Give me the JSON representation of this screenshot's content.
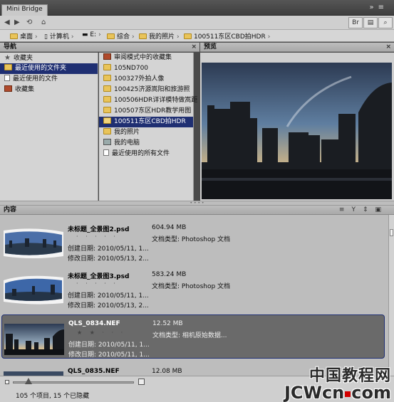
{
  "window": {
    "title": "Mini Bridge"
  },
  "pathbar": {
    "crumbs": [
      "桌面",
      "计算机",
      "E:",
      "综合",
      "我的照片",
      "100511东区CBD拍HDR"
    ]
  },
  "nav_panel": {
    "title": "导航",
    "left_items": [
      {
        "label": "收藏夹",
        "icon": "star-icon"
      },
      {
        "label": "最近使用的文件夹",
        "icon": "recent-folder-icon",
        "selected": true
      },
      {
        "label": "最近使用的文件",
        "icon": "recent-file-icon"
      },
      {
        "label": "收藏集",
        "icon": "collection-icon"
      }
    ],
    "right_items": [
      {
        "label": "审阅模式中的收藏集",
        "icon": "collection-icon"
      },
      {
        "label": "105ND700",
        "icon": "folder-icon"
      },
      {
        "label": "100327外拍人像",
        "icon": "folder-icon"
      },
      {
        "label": "100425济源嵩阳和旅游照",
        "icon": "folder-icon"
      },
      {
        "label": "100506HDR详详模特做嵩距",
        "icon": "folder-icon"
      },
      {
        "label": "100507东区HDR教学用图",
        "icon": "folder-icon"
      },
      {
        "label": "100511东区CBD拍HDR",
        "icon": "folder-icon",
        "selected": true
      },
      {
        "label": "我的照片",
        "icon": "folder-icon"
      },
      {
        "label": "我的电脑",
        "icon": "computer-icon"
      },
      {
        "label": "最近使用的所有文件",
        "icon": "recent-file-icon"
      }
    ]
  },
  "preview_panel": {
    "title": "预览"
  },
  "content_panel": {
    "title": "内容",
    "items": [
      {
        "name": "未标题_全景图2.psd",
        "rating": "· · · · ·",
        "created": "创建日期: 2010/05/11, 1...",
        "modified": "修改日期: 2010/05/13, 2...",
        "size": "604.94 MB",
        "type": "文档类型: Photoshop 文档"
      },
      {
        "name": "未标题_全景图3.psd",
        "rating": "· · · · ·",
        "created": "创建日期: 2010/05/11, 1...",
        "modified": "修改日期: 2010/05/13, 2...",
        "size": "583.24 MB",
        "type": "文档类型: Photoshop 文档"
      },
      {
        "name": "QLS_0834.NEF",
        "rating": "★ ★ · · ·",
        "created": "创建日期: 2010/05/11, 1...",
        "modified": "修改日期: 2010/05/11, 1...",
        "size": "12.52 MB",
        "type": "文档类型: 相机原始数据...",
        "selected": true
      },
      {
        "name": "QLS_0835.NEF",
        "rating": "",
        "created": "",
        "modified": "",
        "size": "12.08 MB",
        "type": ""
      }
    ]
  },
  "status": {
    "text": "105 个项目, 15 个已隐藏"
  },
  "watermark": {
    "line1": "中国教程网",
    "line2_a": "JCWcn",
    "line2_b": "com"
  },
  "colors": {
    "selection": "#1f2f72",
    "folder": "#e9c45a",
    "background": "#4a4a4a"
  }
}
